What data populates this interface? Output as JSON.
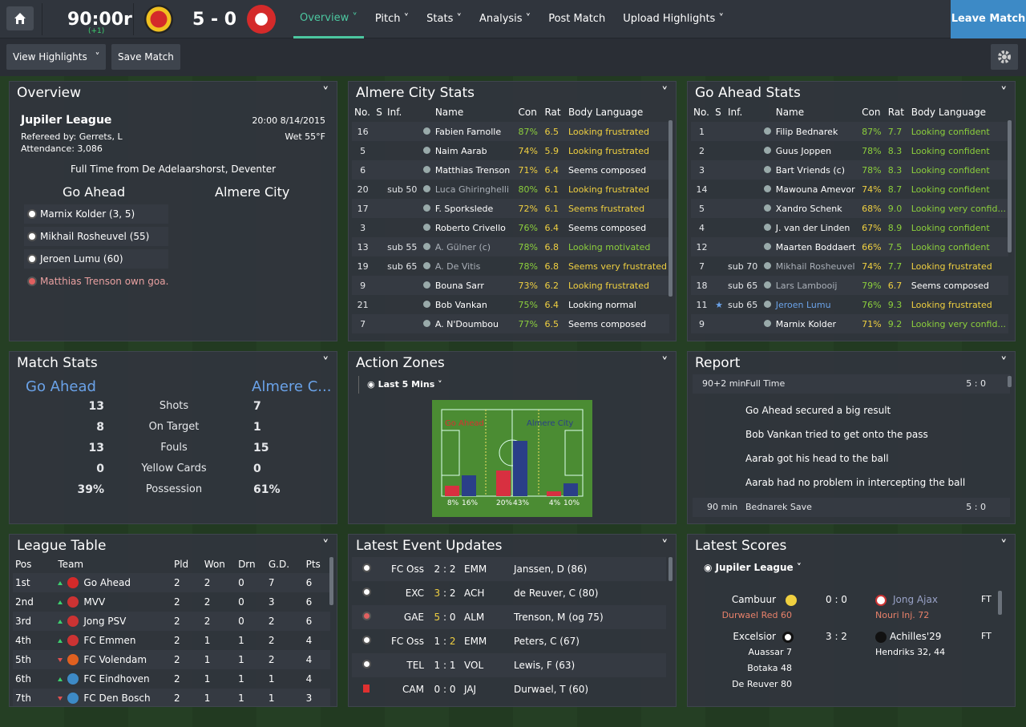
{
  "topbar": {
    "clock": "90:00r",
    "clock_sub": "(+1)",
    "score": "5 - 0",
    "nav": [
      "Overview",
      "Pitch",
      "Stats",
      "Analysis",
      "Post Match",
      "Upload Highlights"
    ],
    "leave": "Leave Match"
  },
  "subbar": {
    "view_highlights": "View Highlights",
    "save_match": "Save Match"
  },
  "overview": {
    "title": "Overview",
    "league": "Jupiler League",
    "datetime": "20:00 8/14/2015",
    "referee": "Refereed by: Gerrets, L",
    "weather": "Wet 55°F",
    "attendance": "Attendance: 3,086",
    "full_time": "Full Time from De Adelaarshorst, Deventer",
    "home": "Go Ahead",
    "away": "Almere City",
    "goals": [
      "Marnix Kolder (3, 5)",
      "Mikhail Rosheuvel (55)",
      "Jeroen Lumu (60)",
      "Matthias Trenson own goa..."
    ]
  },
  "almere_stats": {
    "title": "Almere City Stats",
    "headers": [
      "No.",
      "S",
      "Inf.",
      "Name",
      "Con",
      "Rat",
      "Body Language"
    ],
    "rows": [
      [
        "16",
        "",
        "",
        "Fabien Farnolle",
        "87%",
        "6.5",
        "Looking frustrated"
      ],
      [
        "5",
        "",
        "",
        "Naim Aarab",
        "74%",
        "5.9",
        "Looking frustrated"
      ],
      [
        "6",
        "",
        "",
        "Matthias Trenson",
        "71%",
        "6.4",
        "Seems composed"
      ],
      [
        "20",
        "sub 50",
        "",
        "Luca Ghiringhelli",
        "80%",
        "6.1",
        "Looking frustrated"
      ],
      [
        "17",
        "",
        "",
        "F. Sporkslede",
        "72%",
        "6.1",
        "Seems frustrated"
      ],
      [
        "3",
        "",
        "",
        "Roberto Crivello",
        "76%",
        "6.4",
        "Seems composed"
      ],
      [
        "13",
        "sub 55",
        "",
        "A. Gülner (c)",
        "78%",
        "6.8",
        "Looking motivated"
      ],
      [
        "19",
        "sub 65",
        "",
        "A. De Vitis",
        "78%",
        "6.8",
        "Seems very frustrated"
      ],
      [
        "9",
        "",
        "",
        "Bouna Sarr",
        "73%",
        "6.2",
        "Looking frustrated"
      ],
      [
        "21",
        "",
        "",
        "Bob Vankan",
        "75%",
        "6.4",
        "Looking normal"
      ],
      [
        "7",
        "",
        "",
        "A. N'Doumbou",
        "77%",
        "6.5",
        "Seems composed"
      ]
    ]
  },
  "goahead_stats": {
    "title": "Go Ahead Stats",
    "headers": [
      "No.",
      "S",
      "Inf.",
      "Name",
      "Con",
      "Rat",
      "Body Language"
    ],
    "rows": [
      [
        "1",
        "",
        "",
        "Filip Bednarek",
        "87%",
        "7.7",
        "Looking confident"
      ],
      [
        "2",
        "",
        "",
        "Guus Joppen",
        "78%",
        "8.3",
        "Looking confident"
      ],
      [
        "3",
        "",
        "",
        "Bart Vriends (c)",
        "78%",
        "8.3",
        "Looking confident"
      ],
      [
        "14",
        "",
        "",
        "Mawouna Amevor",
        "74%",
        "8.7",
        "Looking confident"
      ],
      [
        "5",
        "",
        "",
        "Xandro Schenk",
        "68%",
        "9.0",
        "Looking very confid..."
      ],
      [
        "4",
        "",
        "",
        "J. van der Linden",
        "67%",
        "8.9",
        "Looking confident"
      ],
      [
        "12",
        "",
        "",
        "Maarten Boddaert",
        "66%",
        "7.5",
        "Looking confident"
      ],
      [
        "7",
        "sub 70",
        "",
        "Mikhail Rosheuvel",
        "74%",
        "7.7",
        "Looking frustrated"
      ],
      [
        "18",
        "sub 65",
        "",
        "Lars Lambooij",
        "79%",
        "6.7",
        "Seems composed"
      ],
      [
        "11",
        "sub 65",
        "",
        "Jeroen Lumu",
        "76%",
        "9.3",
        "Looking frustrated"
      ],
      [
        "9",
        "",
        "",
        "Marnix Kolder",
        "71%",
        "9.2",
        "Looking very confid..."
      ]
    ]
  },
  "match_stats": {
    "title": "Match Stats",
    "home": "Go Ahead",
    "away": "Almere C...",
    "rows": [
      [
        "13",
        "Shots",
        "7"
      ],
      [
        "8",
        "On Target",
        "1"
      ],
      [
        "13",
        "Fouls",
        "15"
      ],
      [
        "0",
        "Yellow Cards",
        "0"
      ],
      [
        "39%",
        "Possession",
        "61%"
      ]
    ]
  },
  "action_zones": {
    "title": "Action Zones",
    "period": "Last 5 Mins",
    "home_label": "Go Ahead",
    "away_label": "Almere City",
    "pct": [
      "8%",
      "16%",
      "20%",
      "43%",
      "4%",
      "10%"
    ],
    "values": [
      8,
      16,
      20,
      43,
      4,
      10
    ]
  },
  "report": {
    "title": "Report",
    "head1_time": "90+2 min",
    "head1_text": "Full Time",
    "head1_score": "5 : 0",
    "lines": [
      "Go Ahead secured a big result",
      "Bob Vankan tried to get onto the pass",
      "Aarab got his head to the ball",
      "Aarab had no problem in intercepting the ball"
    ],
    "head2_time": "90 min",
    "head2_text": "Bednarek Save",
    "head2_score": "5 : 0"
  },
  "league_table": {
    "title": "League Table",
    "headers": [
      "Pos",
      "Team",
      "Pld",
      "Won",
      "Drn",
      "G.D.",
      "Pts"
    ],
    "rows": [
      [
        "1st",
        "Go Ahead",
        "2",
        "2",
        "0",
        "7",
        "6"
      ],
      [
        "2nd",
        "MVV",
        "2",
        "2",
        "0",
        "3",
        "6"
      ],
      [
        "3rd",
        "Jong PSV",
        "2",
        "2",
        "0",
        "2",
        "6"
      ],
      [
        "4th",
        "FC Emmen",
        "2",
        "1",
        "1",
        "2",
        "4"
      ],
      [
        "5th",
        "FC Volendam",
        "2",
        "1",
        "1",
        "2",
        "4"
      ],
      [
        "6th",
        "FC Eindhoven",
        "2",
        "1",
        "1",
        "1",
        "4"
      ],
      [
        "7th",
        "FC Den Bosch",
        "2",
        "1",
        "1",
        "1",
        "3"
      ]
    ]
  },
  "events": {
    "title": "Latest Event Updates",
    "rows": [
      [
        "FC Oss",
        "2",
        "2",
        "EMM",
        "Janssen, D (86)"
      ],
      [
        "EXC",
        "3",
        "2",
        "ACH",
        "de Reuver, C (80)"
      ],
      [
        "GAE",
        "5",
        "0",
        "ALM",
        "Trenson, M (og 75)"
      ],
      [
        "FC Oss",
        "1",
        "2",
        "EMM",
        "Peters, C (67)"
      ],
      [
        "TEL",
        "1",
        "1",
        "VOL",
        "Lewis, F (63)"
      ],
      [
        "CAM",
        "0",
        "0",
        "JAJ",
        "Durwael, T (60)"
      ]
    ]
  },
  "latest_scores": {
    "title": "Latest Scores",
    "league": "Jupiler League",
    "m1_home": "Cambuur",
    "m1_score": "0 : 0",
    "m1_away": "Jong Ajax",
    "m1_status": "FT",
    "m1_note_home": "Durwael Red 60",
    "m1_note_away": "Nouri Inj. 72",
    "m2_home": "Excelsior",
    "m2_score": "3 : 2",
    "m2_away": "Achilles'29",
    "m2_status": "FT",
    "m2_scorers_home": [
      "Auassar 7",
      "Botaka 48",
      "De Reuver 80"
    ],
    "m2_scorers_away": "Hendriks 32, 44"
  },
  "colors": {
    "accent": "#4cc7a0",
    "leave": "#3d8ac6",
    "home": "#6aa2e8"
  }
}
